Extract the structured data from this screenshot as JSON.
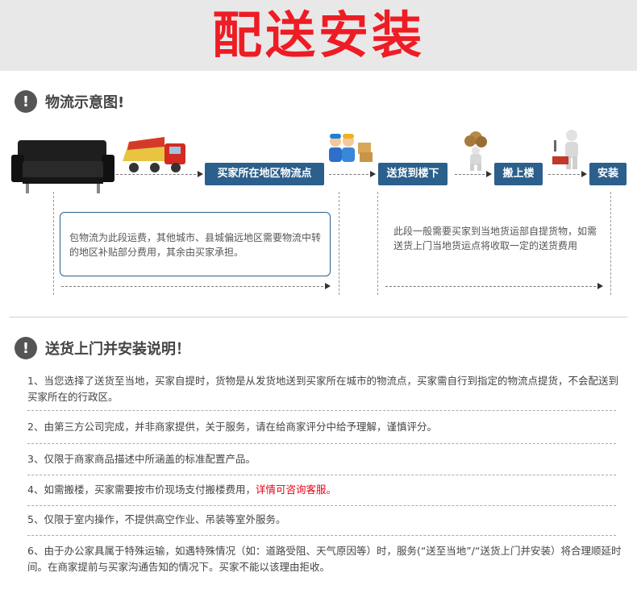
{
  "banner": {
    "title": "配送安装"
  },
  "logistics": {
    "title": "物流示意图!",
    "steps": [
      "买家所在地区物流点",
      "送货到楼下",
      "搬上楼",
      "安装"
    ],
    "note_left": "包物流为此段运费，其他城市、县城偏远地区需要物流中转的地区补贴部分费用，其余由买家承担。",
    "note_right": "此段一般需要买家到当地货运部自提货物，如需送货上门当地货运点将收取一定的送货费用"
  },
  "instructions": {
    "title": "送货上门并安装说明！",
    "items": [
      {
        "text": "1、当您选择了送货至当地，买家自提时，货物是从发货地送到买家所在城市的物流点，买家需自行到指定的物流点提货，不会配送到买家所在的行政区。"
      },
      {
        "text": "2、由第三方公司完成，并非商家提供，关于服务，请在给商家评分中给予理解，谨慎评分。"
      },
      {
        "text": "3、仅限于商家商品描述中所涵盖的标准配置产品。"
      },
      {
        "text": "4、如需搬楼，买家需要按市价现场支付搬楼费用，",
        "highlight": "详情可咨询客服。"
      },
      {
        "text": "5、仅限于室内操作，不提供高空作业、吊装等室外服务。"
      },
      {
        "text": "6、由于办公家具属于特殊运输，如遇特殊情况（如：道路受阻、天气原因等）时，服务(“送至当地”/“送货上门并安装）将合理顺延时间。在商家提前与买家沟通告知的情况下。买家不能以该理由拒收。"
      }
    ]
  },
  "colors": {
    "accent": "#2b5f8c",
    "title_red": "#ee1c24",
    "highlight": "#e60012"
  },
  "icons": [
    "warning-icon",
    "sofa-icon",
    "truck-icon",
    "workers-icon",
    "porter-icon",
    "installer-icon"
  ]
}
